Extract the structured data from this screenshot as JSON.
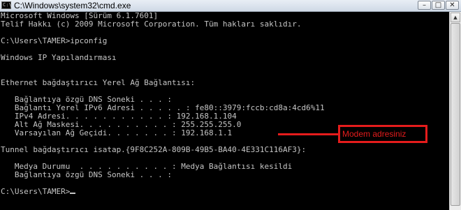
{
  "window": {
    "title": "C:\\Windows\\system32\\cmd.exe",
    "icon": "cmd-icon",
    "icon_glyph": "C:\\",
    "minimize_glyph": "–",
    "maximize_glyph": "□",
    "close_glyph": "✕"
  },
  "console": {
    "lines": [
      "Microsoft Windows [Sürüm 6.1.7601]",
      "Telif Hakkı (c) 2009 Microsoft Corporation. Tüm hakları saklıdır.",
      "",
      "C:\\Users\\TAMER>ipconfig",
      "",
      "Windows IP Yapılandırması",
      "",
      "",
      "Ethernet bağdaştırıcı Yerel Ağ Bağlantısı:",
      "",
      "   Bağlantıya özgü DNS Soneki . . . :",
      "   Bağlantı Yerel IPv6 Adresi . . . . . : fe80::3979:fccb:cd8a:4cd6%11",
      "   IPv4 Adresi. . . . . . . . . . . : 192.168.1.104",
      "   Alt Ağ Maskesi. . . . . . . . . . : 255.255.255.0",
      "   Varsayılan Ağ Geçidi. . . . . . . : 192.168.1.1",
      "",
      "Tunnel bağdaştırıcı isatap.{9F8C252A-809B-49B5-BA40-4E331C116AF3}:",
      "",
      "   Medya Durumu  . . . . . . . . . . : Medya Bağlantısı kesildi",
      "   Bağlantıya özgü DNS Soneki . . . :",
      "",
      "C:\\Users\\TAMER>"
    ],
    "text_color": "#c6c6c6",
    "background": "#000000"
  },
  "annotation": {
    "label": "Modem adresiniz",
    "color": "#e51c1c"
  },
  "scrollbar": {
    "up_glyph": "▲"
  }
}
